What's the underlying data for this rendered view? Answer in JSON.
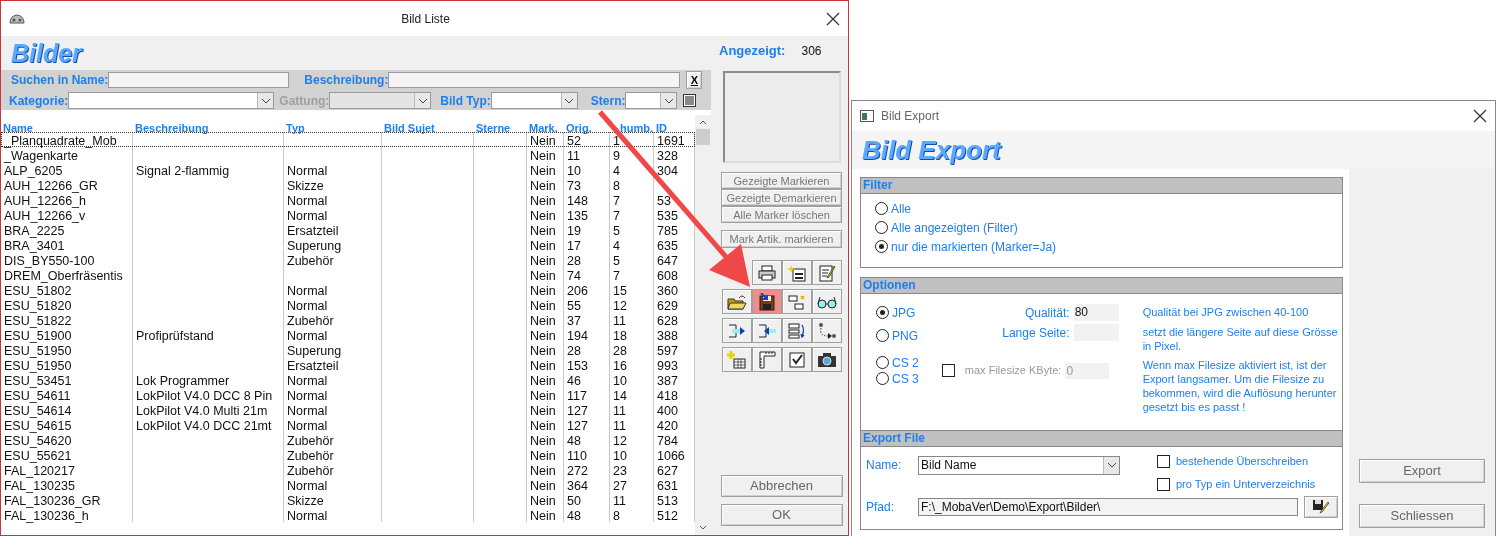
{
  "list_window": {
    "title": "Bild Liste",
    "heading": "Bilder",
    "shown_label": "Angezeigt:",
    "shown_count": "306",
    "filters": {
      "name_label": "Suchen in Name:",
      "description_label": "Beschreibung:",
      "clear_button": "X",
      "category_label": "Kategorie:",
      "genre": {
        "label": "Gattung:",
        "disabled": true
      },
      "type_label": "Bild Typ:",
      "stars_label": "Stern:"
    },
    "table": {
      "columns": [
        "Name",
        "Beschreibung",
        "Typ",
        "Bild Sujet",
        "Sterne",
        "Mark.",
        "Orig.",
        "humb.",
        "ID"
      ],
      "rows": [
        {
          "name": "_Planquadrate_Mob",
          "mark": "Nein",
          "orig": "52",
          "thumb": "1",
          "id": "1691",
          "selected": true
        },
        {
          "name": "_Wagenkarte",
          "mark": "Nein",
          "orig": "11",
          "thumb": "9",
          "id": "328",
          "selected": false
        },
        {
          "name": "ALP_6205",
          "description": "Signal 2-flammig",
          "type": "Normal",
          "mark": "Nein",
          "orig": "10",
          "thumb": "4",
          "id": "304",
          "selected": false
        },
        {
          "name": "AUH_12266_GR",
          "type": "Skizze",
          "mark": "Nein",
          "orig": "73",
          "thumb": "8",
          "selected": false
        },
        {
          "name": "AUH_12266_h",
          "type": "Normal",
          "mark": "Nein",
          "orig": "148",
          "thumb": "7",
          "id": "53",
          "selected": false
        },
        {
          "name": "AUH_12266_v",
          "type": "Normal",
          "mark": "Nein",
          "orig": "135",
          "thumb": "7",
          "id": "535",
          "selected": false
        },
        {
          "name": "BRA_2225",
          "type": "Ersatzteil",
          "mark": "Nein",
          "orig": "19",
          "thumb": "5",
          "id": "785",
          "selected": false
        },
        {
          "name": "BRA_3401",
          "type": "Superung",
          "mark": "Nein",
          "orig": "17",
          "thumb": "4",
          "id": "635",
          "selected": false
        },
        {
          "name": "DIS_BY550-100",
          "type": "Zubehör",
          "mark": "Nein",
          "orig": "28",
          "thumb": "5",
          "id": "647",
          "selected": false
        },
        {
          "name": "DREM_Oberfräsentis",
          "mark": "Nein",
          "orig": "74",
          "thumb": "7",
          "id": "608",
          "selected": false
        },
        {
          "name": "ESU_51802",
          "type": "Normal",
          "mark": "Nein",
          "orig": "206",
          "thumb": "15",
          "id": "360",
          "selected": false
        },
        {
          "name": "ESU_51820",
          "type": "Normal",
          "mark": "Nein",
          "orig": "55",
          "thumb": "12",
          "id": "629",
          "selected": false
        },
        {
          "name": "ESU_51822",
          "type": "Zubehör",
          "mark": "Nein",
          "orig": "37",
          "thumb": "11",
          "id": "628",
          "selected": false
        },
        {
          "name": "ESU_51900",
          "description": "Profiprüfstand",
          "type": "Normal",
          "mark": "Nein",
          "orig": "194",
          "thumb": "18",
          "id": "388",
          "selected": false
        },
        {
          "name": "ESU_51950",
          "type": "Superung",
          "mark": "Nein",
          "orig": "28",
          "thumb": "28",
          "id": "597",
          "selected": false
        },
        {
          "name": "ESU_51950",
          "type": "Ersatzteil",
          "mark": "Nein",
          "orig": "153",
          "thumb": "16",
          "id": "993",
          "selected": false
        },
        {
          "name": "ESU_53451",
          "description": "Lok Programmer",
          "type": "Normal",
          "mark": "Nein",
          "orig": "46",
          "thumb": "10",
          "id": "387",
          "selected": false
        },
        {
          "name": "ESU_54611",
          "description": "LokPilot V4.0 DCC 8 Pin",
          "type": "Normal",
          "mark": "Nein",
          "orig": "117",
          "thumb": "14",
          "id": "418",
          "selected": false
        },
        {
          "name": "ESU_54614",
          "description": "LokPilot V4.0 Multi 21m",
          "type": "Normal",
          "mark": "Nein",
          "orig": "127",
          "thumb": "11",
          "id": "400",
          "selected": false
        },
        {
          "name": "ESU_54615",
          "description": "LokPilot V4.0 DCC 21mt",
          "type": "Normal",
          "mark": "Nein",
          "orig": "127",
          "thumb": "11",
          "id": "420",
          "selected": false
        },
        {
          "name": "ESU_54620",
          "type": "Zubehör",
          "mark": "Nein",
          "orig": "48",
          "thumb": "12",
          "id": "784",
          "selected": false
        },
        {
          "name": "ESU_55621",
          "type": "Zubehör",
          "mark": "Nein",
          "orig": "110",
          "thumb": "10",
          "id": "1066",
          "selected": false
        },
        {
          "name": "FAL_120217",
          "type": "Zubehör",
          "mark": "Nein",
          "orig": "272",
          "thumb": "23",
          "id": "627",
          "selected": false
        },
        {
          "name": "FAL_130235",
          "type": "Normal",
          "mark": "Nein",
          "orig": "364",
          "thumb": "27",
          "id": "631",
          "selected": false
        },
        {
          "name": "FAL_130236_GR",
          "type": "Skizze",
          "mark": "Nein",
          "orig": "50",
          "thumb": "11",
          "id": "513",
          "selected": false
        },
        {
          "name": "FAL_130236_h",
          "type": "Normal",
          "mark": "Nein",
          "orig": "48",
          "thumb": "8",
          "id": "512",
          "selected": false
        }
      ]
    },
    "mark_buttons": [
      {
        "label": "Gezeigte Markieren",
        "disabled": true
      },
      {
        "label": "Gezeigte Demarkieren",
        "disabled": true
      },
      {
        "label": "Alle Marker löschen",
        "disabled": true
      }
    ],
    "mark_articles_button": {
      "label": "Mark Artik. markieren",
      "disabled": true
    },
    "toolbar": [
      {
        "kind": "print",
        "highlighted": false
      },
      {
        "kind": "new-form",
        "highlighted": false
      },
      {
        "kind": "edit-note",
        "highlighted": false
      },
      {
        "kind": "open-folder",
        "highlighted": false
      },
      {
        "kind": "save",
        "highlighted": true
      },
      {
        "kind": "resize",
        "highlighted": false
      },
      {
        "kind": "glasses",
        "highlighted": false
      },
      {
        "kind": "export-right",
        "highlighted": false
      },
      {
        "kind": "import-left",
        "highlighted": false
      },
      {
        "kind": "list-sort",
        "highlighted": false
      },
      {
        "kind": "dotted-arrow",
        "highlighted": false
      },
      {
        "kind": "add-table",
        "highlighted": false
      },
      {
        "kind": "ruler",
        "highlighted": false
      },
      {
        "kind": "checkbox",
        "highlighted": false
      },
      {
        "kind": "camera",
        "highlighted": false
      }
    ],
    "buttons": [
      "Abbrechen",
      "OK"
    ]
  },
  "export_dialog": {
    "title": "Bild Export",
    "heading": "Bild Export",
    "filter": {
      "title": "Filter",
      "options": [
        {
          "label": "Alle",
          "selected": false
        },
        {
          "label": "Alle angezeigten (Filter)",
          "selected": false
        },
        {
          "label": "nur die markierten (Marker=Ja)",
          "selected": true
        }
      ]
    },
    "options": {
      "title": "Optionen",
      "formats": [
        {
          "label": "JPG",
          "selected": true
        },
        {
          "label": "PNG",
          "selected": false
        },
        {
          "label": "CS 2",
          "selected": false
        },
        {
          "label": "CS 3",
          "selected": false
        }
      ],
      "quality_label": "Qualität:",
      "quality_value": "80",
      "long_side_label": "Lange Seite:",
      "max_filesize": {
        "label": "max Filesize KByte:",
        "checked": false,
        "value": "0"
      },
      "notes": [
        "Qualität bei JPG zwischen 40-100",
        "setzt die längere Seite auf diese Grösse in Pixel.",
        "Wenn max Filesize aktiviert ist, ist der Export langsamer. Um die Filesize zu bekommen, wird die Auflösung herunter gesetzt bis es passt !"
      ]
    },
    "export_file": {
      "title": "Export File",
      "name_label": "Name:",
      "name_value": "Bild Name",
      "checkboxes": [
        {
          "label": "bestehende Überschreiben",
          "checked": false
        },
        {
          "label": "pro Typ ein Unterverzeichnis",
          "checked": false
        }
      ],
      "path_label": "Pfad:",
      "path_value": "F:\\_MobaVer\\Demo\\Export\\Bilder\\"
    },
    "buttons": [
      "Export",
      "Schliessen"
    ]
  }
}
